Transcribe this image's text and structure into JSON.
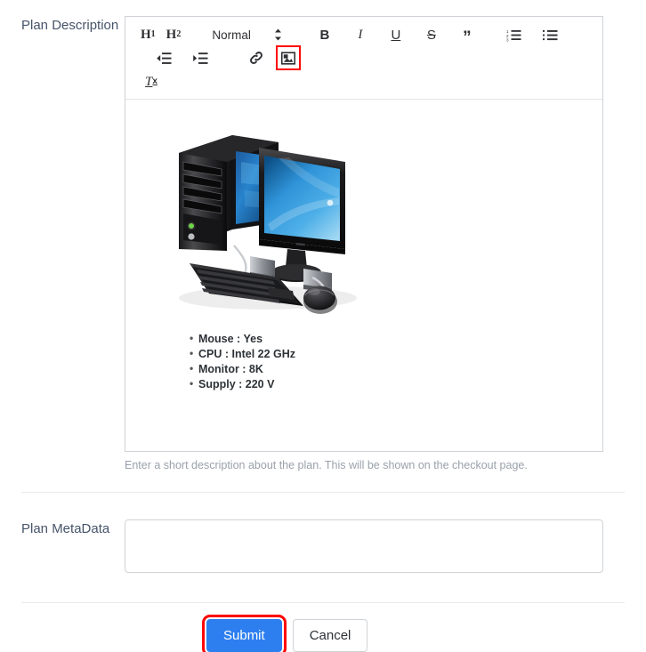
{
  "form": {
    "description_field": {
      "label": "Plan Description",
      "help_text": "Enter a short description about the plan. This will be shown on the checkout page.",
      "editor": {
        "toolbar": {
          "heading1": "H",
          "heading1_sub": "1",
          "heading2": "H",
          "heading2_sub": "2",
          "format_picker_value": "Normal",
          "bold": "B",
          "italic": "I",
          "underline": "U",
          "strikethrough": "S",
          "blockquote": "”",
          "clear_format": "T",
          "clear_format_sub": "x",
          "icons": {
            "ordered_list": "ordered-list-icon",
            "bullet_list": "bullet-list-icon",
            "outdent": "outdent-icon",
            "indent": "indent-icon",
            "link": "link-icon",
            "image": "image-icon",
            "picker_chevrons": "chevron-up-down-icon"
          },
          "highlighted_button": "image-icon"
        },
        "content": {
          "image_alt": "desktop-computer-illustration",
          "specs": [
            "Mouse : Yes",
            "CPU : Intel 22 GHz",
            "Monitor : 8K",
            "Supply : 220 V"
          ]
        }
      }
    },
    "metadata_field": {
      "label": "Plan MetaData",
      "value": "",
      "placeholder": ""
    },
    "actions": {
      "submit_label": "Submit",
      "cancel_label": "Cancel",
      "highlighted_button": "submit-button"
    }
  },
  "colors": {
    "primary": "#2d7ff0",
    "highlight": "#ff0000",
    "label_text": "#46546a",
    "help_text": "#9aa1ab",
    "border": "#cfd3d7"
  }
}
